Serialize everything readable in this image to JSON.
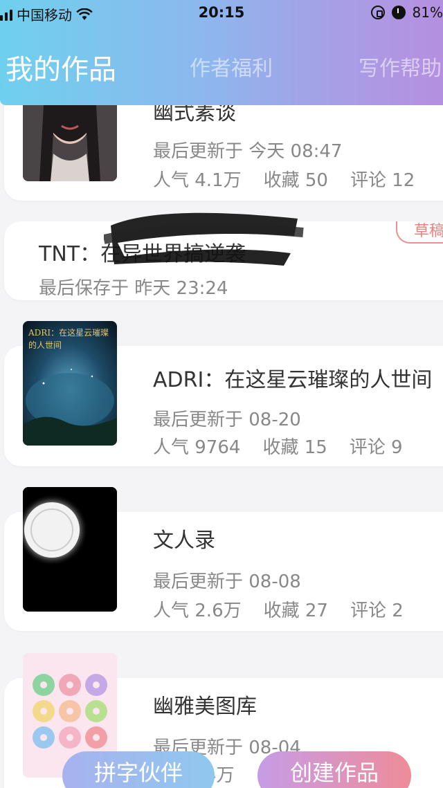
{
  "status_bar": {
    "carrier": "中国移动",
    "time": "20:15",
    "battery": "81%"
  },
  "tabs": [
    {
      "label": "我的作品",
      "active": true
    },
    {
      "label": "作者福利",
      "active": false
    },
    {
      "label": "写作帮助",
      "active": false
    }
  ],
  "works": [
    {
      "title": "幽式素谈",
      "updated": "最后更新于 今天 08:47",
      "popularity": "人气 4.1万",
      "favorites": "收藏 50",
      "comments": "评论 12"
    },
    {
      "title": "TNT：在异世界搞逆袭",
      "saved": "最后保存于 昨天 23:24",
      "badge": "草稿"
    },
    {
      "title": "ADRI：在这星云璀璨的人世间",
      "cover_text": "ADRI：在这星云璀璨的人世间",
      "updated": "最后更新于 08-20",
      "popularity": "人气 9764",
      "favorites": "收藏 15",
      "comments": "评论 9"
    },
    {
      "title": "文人录",
      "updated": "最后更新于 08-08",
      "popularity": "人气 2.6万",
      "favorites": "收藏 27",
      "comments": "评论 2"
    },
    {
      "title": "幽雅美图库",
      "updated": "最后更新于 08-04",
      "popularity": "4万"
    }
  ],
  "buttons": {
    "partner": "拼字伙伴",
    "create": "创建作品"
  },
  "colors": {
    "header_gradient_start": "#6fd0ee",
    "header_gradient_end": "#b58fe0",
    "draft_badge": "#ef7f7f"
  }
}
